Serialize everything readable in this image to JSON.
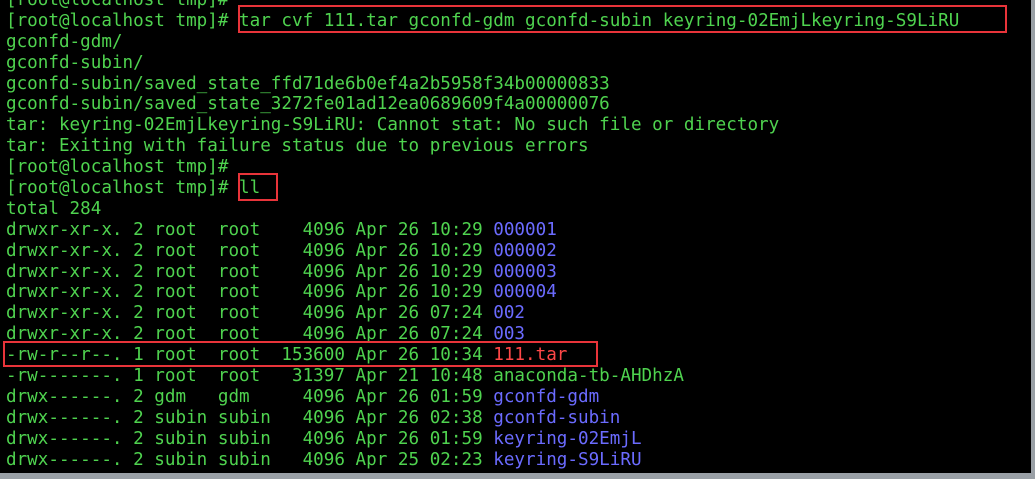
{
  "terminal": {
    "prompt": "[root@localhost tmp]#",
    "partial_top_line": "[root@localhost tmp]#",
    "commands": {
      "tar": "tar cvf 111.tar gconfd-gdm gconfd-subin keyring-02EmjLkeyring-S9LiRU",
      "ll": "ll"
    },
    "tar_output": [
      "gconfd-gdm/",
      "gconfd-subin/",
      "gconfd-subin/saved_state_ffd71de6b0ef4a2b5958f34b00000833",
      "gconfd-subin/saved_state_3272fe01ad12ea0689609f4a00000076",
      "tar: keyring-02EmjLkeyring-S9LiRU: Cannot stat: No such file or directory",
      "tar: Exiting with failure status due to previous errors"
    ],
    "total": "total 284",
    "listing": [
      {
        "prefix": "drwxr-xr-x. 2 root  root    4096 Apr 26 10:29 ",
        "name": "000001",
        "kind": "dir"
      },
      {
        "prefix": "drwxr-xr-x. 2 root  root    4096 Apr 26 10:29 ",
        "name": "000002",
        "kind": "dir"
      },
      {
        "prefix": "drwxr-xr-x. 2 root  root    4096 Apr 26 10:29 ",
        "name": "000003",
        "kind": "dir"
      },
      {
        "prefix": "drwxr-xr-x. 2 root  root    4096 Apr 26 10:29 ",
        "name": "000004",
        "kind": "dir"
      },
      {
        "prefix": "drwxr-xr-x. 2 root  root    4096 Apr 26 07:24 ",
        "name": "002",
        "kind": "dir"
      },
      {
        "prefix": "drwxr-xr-x. 2 root  root    4096 Apr 26 07:24 ",
        "name": "003",
        "kind": "dir"
      },
      {
        "prefix": "-rw-r--r--. 1 root  root  153600 Apr 26 10:34 ",
        "name": "111.tar",
        "kind": "archive"
      },
      {
        "prefix": "-rw-------. 1 root  root   31397 Apr 21 10:48 ",
        "name": "anaconda-tb-AHDhzA",
        "kind": "file"
      },
      {
        "prefix": "drwx------. 2 gdm   gdm     4096 Apr 26 01:59 ",
        "name": "gconfd-gdm",
        "kind": "dir"
      },
      {
        "prefix": "drwx------. 2 subin subin   4096 Apr 26 02:38 ",
        "name": "gconfd-subin",
        "kind": "dir"
      },
      {
        "prefix": "drwx------. 2 subin subin   4096 Apr 26 01:59 ",
        "name": "keyring-02EmjL",
        "kind": "dir"
      },
      {
        "prefix": "drwx------. 2 subin subin   4096 Apr 25 02:23 ",
        "name": "keyring-S9LiRU",
        "kind": "dir"
      }
    ]
  },
  "colors": {
    "background": "#000000",
    "text": "#4fd34f",
    "directory": "#6b6bff",
    "archive": "#ff4747",
    "highlight_box": "#e8343a"
  }
}
